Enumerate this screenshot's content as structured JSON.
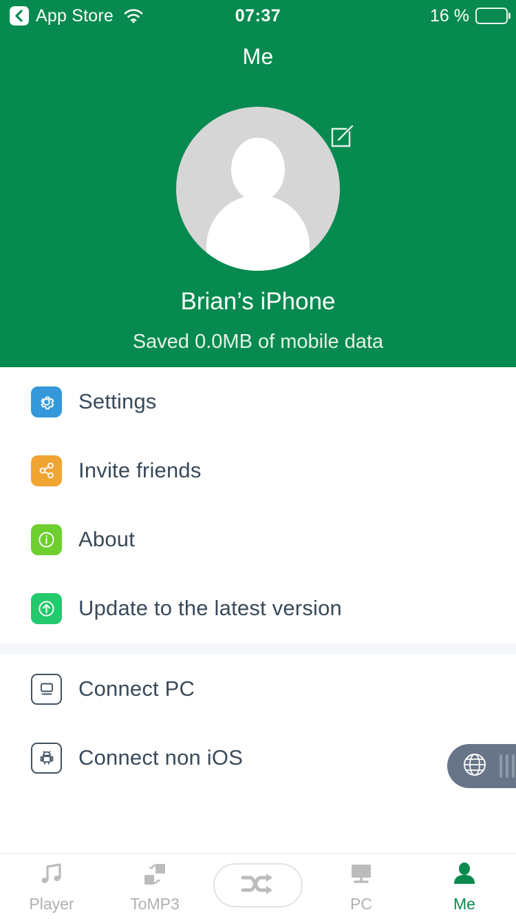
{
  "statusbar": {
    "back_label": "App Store",
    "back_icon": "chevron-left-icon",
    "wifi_icon": "wifi-icon",
    "time": "07:37",
    "battery_text": "16 %",
    "battery_percent": 16,
    "battery_icon": "battery-low-icon"
  },
  "header": {
    "title": "Me",
    "avatar_icon": "person-placeholder-avatar",
    "edit_icon": "edit-pencil-square-icon",
    "device_name": "Brian’s iPhone",
    "saved_data": "Saved 0.0MB of mobile data",
    "background_color": "#068a4f"
  },
  "menu_groups": [
    {
      "items": [
        {
          "label": "Settings",
          "icon": "gear-icon",
          "icon_color": "#3498db",
          "style": "filled"
        },
        {
          "label": "Invite friends",
          "icon": "share-nodes-icon",
          "icon_color": "#f0a431",
          "style": "filled"
        },
        {
          "label": "About",
          "icon": "info-circle-icon",
          "icon_color": "#6ece2e",
          "style": "filled"
        },
        {
          "label": "Update to the latest version",
          "icon": "arrow-up-circle-icon",
          "icon_color": "#23c96c",
          "style": "filled"
        }
      ]
    },
    {
      "items": [
        {
          "label": "Connect PC",
          "icon": "monitor-icon",
          "icon_color": "#3f5061",
          "style": "outline"
        },
        {
          "label": "Connect non iOS",
          "icon": "android-robot-icon",
          "icon_color": "#3f5061",
          "style": "outline"
        }
      ]
    }
  ],
  "floating_widget": {
    "icon": "globe-icon",
    "handle_icon": "drag-handle-icon",
    "color": "#687589"
  },
  "tabbar": {
    "tabs": [
      {
        "label": "Player",
        "icon": "music-note-icon",
        "active": false
      },
      {
        "label": "ToMP3",
        "icon": "convert-squares-icon",
        "active": false
      },
      {
        "label": "PC",
        "icon": "monitor-icon",
        "active": false
      },
      {
        "label": "Me",
        "icon": "person-icon",
        "active": true
      }
    ],
    "center_button_icon": "shuffle-icon",
    "active_color": "#0b8a4f",
    "inactive_color": "#b0b0b0"
  }
}
